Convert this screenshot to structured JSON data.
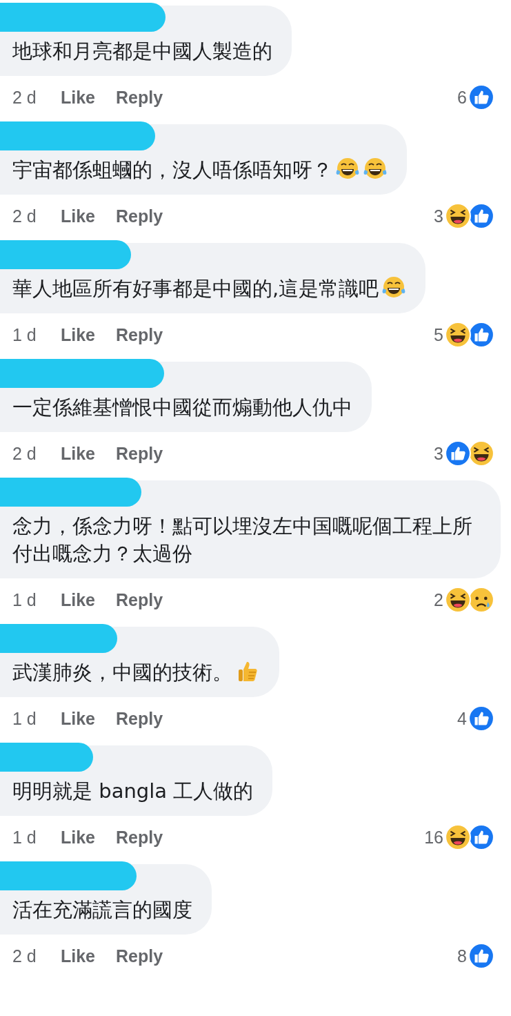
{
  "comments": [
    {
      "text": "地球和月亮都是中國人製造的",
      "time": "2 d",
      "like": "Like",
      "reply": "Reply",
      "count": "6",
      "reactions": [
        {
          "kind": "like"
        }
      ]
    },
    {
      "text": "宇宙都係蛆蟈的，沒人唔係唔知呀？",
      "emojis": [
        {
          "kind": "tears_of_joy"
        },
        {
          "kind": "tears_of_joy"
        }
      ],
      "time": "2 d",
      "like": "Like",
      "reply": "Reply",
      "count": "3",
      "reactions": [
        {
          "kind": "haha"
        },
        {
          "kind": "like"
        }
      ]
    },
    {
      "text": "華人地區所有好事都是中國的,這是常識吧",
      "emojis": [
        {
          "kind": "tears_of_joy"
        }
      ],
      "time": "1 d",
      "like": "Like",
      "reply": "Reply",
      "count": "5",
      "reactions": [
        {
          "kind": "haha"
        },
        {
          "kind": "like"
        }
      ]
    },
    {
      "text": "一定係維基憎恨中國從而煽動他人仇中",
      "time": "2 d",
      "like": "Like",
      "reply": "Reply",
      "count": "3",
      "reactions": [
        {
          "kind": "like"
        },
        {
          "kind": "haha"
        }
      ]
    },
    {
      "text": "念力，係念力呀！點可以埋沒左中国嘅呢個工程上所付出嘅念力？太過份",
      "time": "1 d",
      "like": "Like",
      "reply": "Reply",
      "count": "2",
      "reactions": [
        {
          "kind": "haha"
        },
        {
          "kind": "sad"
        }
      ]
    },
    {
      "text": "武漢肺炎，中國的技術。",
      "emojis": [
        {
          "kind": "thumbs_up"
        }
      ],
      "time": "1 d",
      "like": "Like",
      "reply": "Reply",
      "count": "4",
      "reactions": [
        {
          "kind": "like"
        }
      ]
    },
    {
      "text": "明明就是 bangla 工人做的",
      "time": "1 d",
      "like": "Like",
      "reply": "Reply",
      "count": "16",
      "reactions": [
        {
          "kind": "haha"
        },
        {
          "kind": "like"
        }
      ]
    },
    {
      "text": "活在充滿謊言的國度",
      "time": "2 d",
      "like": "Like",
      "reply": "Reply",
      "count": "8",
      "reactions": [
        {
          "kind": "like"
        }
      ]
    }
  ]
}
